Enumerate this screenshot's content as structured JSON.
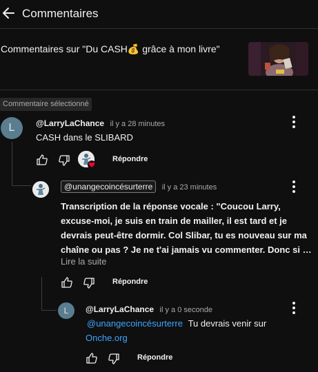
{
  "header": {
    "title": "Commentaires"
  },
  "video": {
    "title": "Commentaires sur \"Du CASH💰 grâce à mon livre\""
  },
  "selected_badge": "Commentaire sélectionné",
  "comments": [
    {
      "avatar_letter": "L",
      "author": "@LarryLaChance",
      "time": "il y a 28 minutes",
      "text": "CASH dans le SLIBARD",
      "reply_label": "Répondre"
    },
    {
      "author": "@unangecoincésurterre",
      "time": "il y a 23 minutes",
      "text_lines": [
        "Transcription de la réponse vocale : \"Coucou Larry,",
        "excuse-moi, je suis en train de mailler, il est tard et je",
        "devrais peut-être dormir. Col Slibar, tu es nouveau sur ma",
        "chaîne ou pas ? Je ne t'ai jamais vu commenter. Donc si …"
      ],
      "read_more": "Lire la suite",
      "reply_label": "Répondre"
    },
    {
      "avatar_letter": "L",
      "author": "@LarryLaChance",
      "time": "il y a 0 seconde",
      "mention": "@unangecoincésurterre",
      "text": "Tu devrais venir sur",
      "link": "Onche.org",
      "reply_label": "Répondre"
    }
  ],
  "colors": {
    "background": "#0f0f0f",
    "link": "#3ea6ff",
    "heart": "#ff0033",
    "muted": "#aaaaaa"
  },
  "icons": [
    "back-arrow-icon",
    "more-vert-icon",
    "thumb-up-icon",
    "thumb-down-icon",
    "heart-icon"
  ]
}
